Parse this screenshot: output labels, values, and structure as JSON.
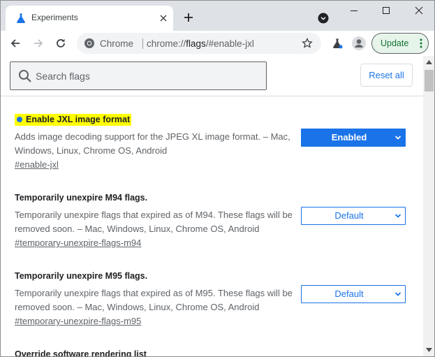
{
  "colors": {
    "accent": "#1a73e8",
    "highlight": "#ffff00",
    "update_green": "#137333",
    "text_secondary": "#5f6368"
  },
  "tab": {
    "title": "Experiments",
    "icon": "flask-icon"
  },
  "omnibox": {
    "chip": "Chrome",
    "url_scheme": "chrome://",
    "url_host": "flags",
    "url_path": "/#enable-jxl"
  },
  "toolbar": {
    "update_label": "Update"
  },
  "search": {
    "placeholder": "Search flags",
    "value": ""
  },
  "reset_label": "Reset all",
  "flags": [
    {
      "title": "Enable JXL image format",
      "description": "Adds image decoding support for the JPEG XL image format. – Mac, Windows, Linux, Chrome OS, Android",
      "link": "#enable-jxl",
      "value": "Enabled",
      "highlighted": true
    },
    {
      "title": "Temporarily unexpire M94 flags.",
      "description": "Temporarily unexpire flags that expired as of M94. These flags will be removed soon. – Mac, Windows, Linux, Chrome OS, Android",
      "link": "#temporary-unexpire-flags-m94",
      "value": "Default"
    },
    {
      "title": "Temporarily unexpire M95 flags.",
      "description": "Temporarily unexpire flags that expired as of M95. These flags will be removed soon. – Mac, Windows, Linux, Chrome OS, Android",
      "link": "#temporary-unexpire-flags-m95",
      "value": "Default"
    },
    {
      "title": "Override software rendering list"
    }
  ]
}
